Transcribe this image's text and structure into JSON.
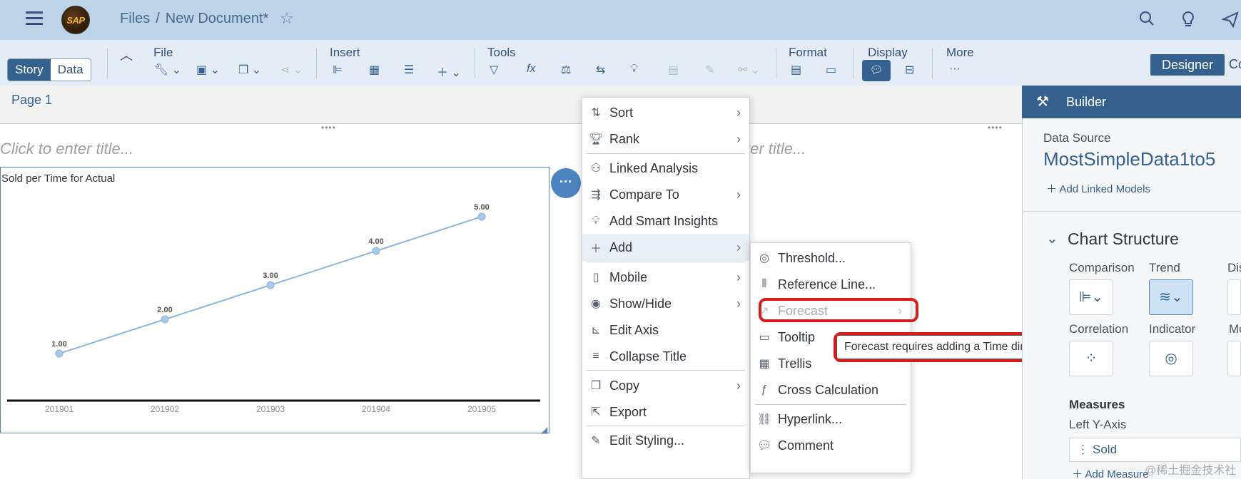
{
  "shell": {
    "breadcrumb_root": "Files",
    "breadcrumb_sep": "/",
    "document_title": "New Document*",
    "logo_text": "SAP"
  },
  "toolbar": {
    "mode_story": "Story",
    "mode_data": "Data",
    "groups": {
      "file": "File",
      "insert": "Insert",
      "tools": "Tools",
      "format": "Format",
      "display": "Display",
      "more": "More"
    },
    "designer": "Designer",
    "co_truncated": "Co"
  },
  "page": {
    "tab_label": "Page 1",
    "title_placeholder": "Click to enter title...",
    "title_placeholder_right": "ter title..."
  },
  "chart_data": {
    "type": "line",
    "title": "Sold per Time for Actual",
    "categories": [
      "201901",
      "201902",
      "201903",
      "201904",
      "201905"
    ],
    "series": [
      {
        "values": [
          1.0,
          2.0,
          3.0,
          4.0,
          5.0
        ]
      }
    ],
    "data_labels": [
      "1.00",
      "2.00",
      "3.00",
      "4.00",
      "5.00"
    ],
    "color": "#8fb6dd",
    "grid": false
  },
  "context_menu": {
    "items": [
      {
        "label": "Sort",
        "icon": "sort-icon",
        "submenu": true
      },
      {
        "label": "Rank",
        "icon": "trophy-icon",
        "submenu": true
      },
      {
        "label": "Linked Analysis",
        "icon": "linked-analysis-icon",
        "submenu": false
      },
      {
        "label": "Compare To",
        "icon": "compare-icon",
        "submenu": true
      },
      {
        "label": "Add Smart Insights",
        "icon": "lightbulb-icon",
        "submenu": false
      },
      {
        "label": "Add",
        "icon": "plus-icon",
        "submenu": true
      },
      {
        "label": "Mobile",
        "icon": "mobile-icon",
        "submenu": true
      },
      {
        "label": "Show/Hide",
        "icon": "eye-icon",
        "submenu": true
      },
      {
        "label": "Edit Axis",
        "icon": "axis-icon",
        "submenu": false
      },
      {
        "label": "Collapse Title",
        "icon": "collapse-title-icon",
        "submenu": false
      },
      {
        "label": "Copy",
        "icon": "copy-icon",
        "submenu": true
      },
      {
        "label": "Export",
        "icon": "export-icon",
        "submenu": false
      },
      {
        "label": "Edit Styling...",
        "icon": "paint-brush-icon",
        "submenu": false
      }
    ]
  },
  "add_submenu": {
    "items": [
      {
        "label": "Threshold...",
        "icon": "threshold-icon",
        "submenu": false,
        "disabled": false
      },
      {
        "label": "Reference Line...",
        "icon": "reference-line-icon",
        "submenu": false,
        "disabled": false
      },
      {
        "label": "Forecast",
        "icon": "forecast-icon",
        "submenu": true,
        "disabled": true
      },
      {
        "label": "Tooltip",
        "icon": "tooltip-icon",
        "submenu": false,
        "disabled": false
      },
      {
        "label": "Trellis",
        "icon": "trellis-icon",
        "submenu": false,
        "disabled": false
      },
      {
        "label": "Cross Calculation",
        "icon": "function-icon",
        "submenu": false,
        "disabled": false
      },
      {
        "label": "Hyperlink...",
        "icon": "link-icon",
        "submenu": false,
        "disabled": false
      },
      {
        "label": "Comment",
        "icon": "comment-add-icon",
        "submenu": false,
        "disabled": false
      }
    ],
    "tooltip_text": "Forecast requires adding a Time dimension to the chart",
    "highlight_color": "#d81b1b"
  },
  "builder": {
    "title": "Builder",
    "data_source_label": "Data Source",
    "data_source_value": "MostSimpleData1to5",
    "add_linked_models": "Add Linked Models",
    "section_title": "Chart Structure",
    "categories": {
      "comparison": "Comparison",
      "trend": "Trend",
      "dis_truncated": "Dis",
      "correlation": "Correlation",
      "indicator": "Indicator",
      "mo_truncated": "Mo"
    },
    "measures_heading": "Measures",
    "left_y_axis": "Left Y-Axis",
    "measure_value": "Sold",
    "add_measure": "Add Measure"
  },
  "watermark": "@稀土掘金技术社区",
  "colors": {
    "shell_bg": "#bcd3e8",
    "toolbar_bg": "#e4edf6",
    "accent": "#35618f",
    "callout": "#d81b1b"
  }
}
